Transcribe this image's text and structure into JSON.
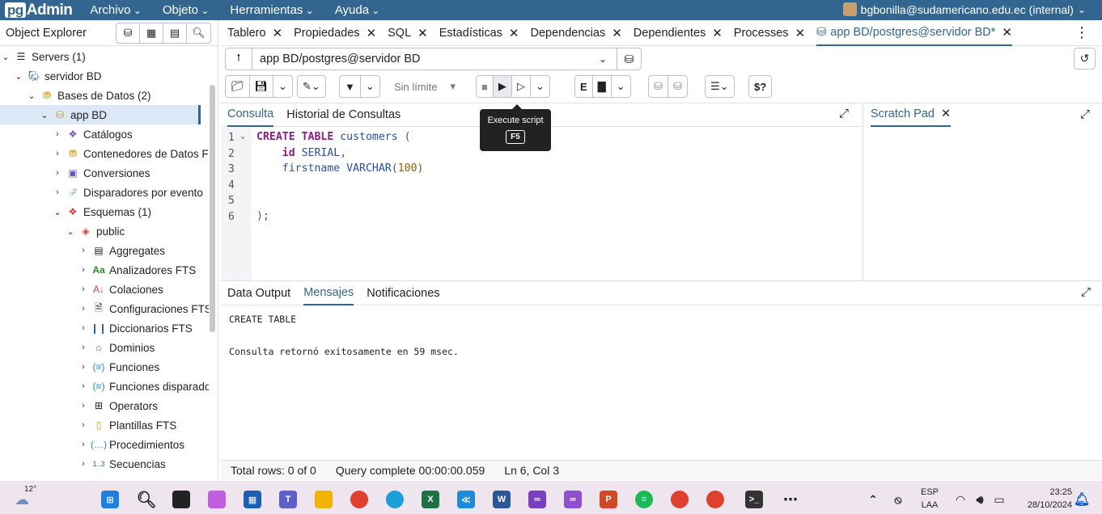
{
  "app": {
    "logo_prefix": "pg",
    "logo_name": "Admin",
    "menus": [
      "Archivo",
      "Objeto",
      "Herramientas",
      "Ayuda"
    ],
    "user": "bgbonilla@sudamericano.edu.ec (internal)"
  },
  "explorer": {
    "title": "Object Explorer",
    "tree": [
      {
        "label": "Servers (1)",
        "icon": "server-group-icon"
      },
      {
        "label": "servidor BD",
        "icon": "elephant-icon"
      },
      {
        "label": "Bases de Datos (2)",
        "icon": "databases-icon"
      },
      {
        "label": "app BD",
        "icon": "database-icon"
      },
      {
        "label": "Catálogos",
        "icon": "catalog-icon"
      },
      {
        "label": "Contenedores de Datos Fo",
        "icon": "fdw-icon"
      },
      {
        "label": "Conversiones",
        "icon": "cast-icon"
      },
      {
        "label": "Disparadores por evento",
        "icon": "event-trigger-icon"
      },
      {
        "label": "Esquemas (1)",
        "icon": "schemas-icon"
      },
      {
        "label": "public",
        "icon": "schema-icon"
      },
      {
        "label": "Aggregates",
        "icon": "aggregate-icon"
      },
      {
        "label": "Analizadores FTS",
        "icon": "fts-parser-icon"
      },
      {
        "label": "Colaciones",
        "icon": "collation-icon"
      },
      {
        "label": "Configuraciones FTS",
        "icon": "fts-config-icon"
      },
      {
        "label": "Diccionarios FTS",
        "icon": "fts-dictionary-icon"
      },
      {
        "label": "Dominios",
        "icon": "domain-icon"
      },
      {
        "label": "Funciones",
        "icon": "function-icon"
      },
      {
        "label": "Funciones disparado",
        "icon": "trigger-function-icon"
      },
      {
        "label": "Operators",
        "icon": "operator-icon"
      },
      {
        "label": "Plantillas FTS",
        "icon": "fts-template-icon"
      },
      {
        "label": "Procedimientos",
        "icon": "procedure-icon"
      },
      {
        "label": "Secuencias",
        "icon": "sequence-icon"
      }
    ]
  },
  "tabs": [
    {
      "label": "Tablero"
    },
    {
      "label": "Propiedades"
    },
    {
      "label": "SQL"
    },
    {
      "label": "Estadísticas"
    },
    {
      "label": "Dependencias"
    },
    {
      "label": "Dependientes"
    },
    {
      "label": "Processes"
    },
    {
      "label": "app BD/postgres@servidor BD*"
    }
  ],
  "connection": {
    "value": "app BD/postgres@servidor BD"
  },
  "toolbar": {
    "limit": "Sin límite",
    "tooltip_title": "Execute script",
    "tooltip_key": "F5"
  },
  "query_tabs": [
    "Consulta",
    "Historial de Consultas"
  ],
  "scratch_pad": "Scratch Pad",
  "editor": {
    "line_numbers": [
      "1",
      "2",
      "3",
      "4",
      "5",
      "6"
    ],
    "lines": [
      {
        "kw": "CREATE TABLE",
        "name": " customers",
        "rest": " ("
      },
      {
        "kw": "    id",
        "name": " SERIAL",
        "rest": ","
      },
      {
        "kw": "",
        "name": "    firstname VARCHAR",
        "rest": "(",
        "num": "100",
        "end": ")"
      },
      {
        "kw": "",
        "name": "",
        "rest": ""
      },
      {
        "kw": "",
        "name": "",
        "rest": ""
      },
      {
        "kw": "",
        "name": "",
        "rest": ");"
      }
    ]
  },
  "result_tabs": [
    "Data Output",
    "Mensajes",
    "Notificaciones"
  ],
  "messages": [
    "CREATE TABLE",
    "Consulta retornó exitosamente en 59 msec."
  ],
  "status": {
    "rows": "Total rows: 0 of 0",
    "query": "Query complete 00:00:00.059",
    "pos": "Ln 6, Col 3"
  },
  "taskbar": {
    "weather": "12°",
    "lang1": "ESP",
    "lang2": "LAA",
    "time": "23:25",
    "date": "28/10/2024"
  }
}
